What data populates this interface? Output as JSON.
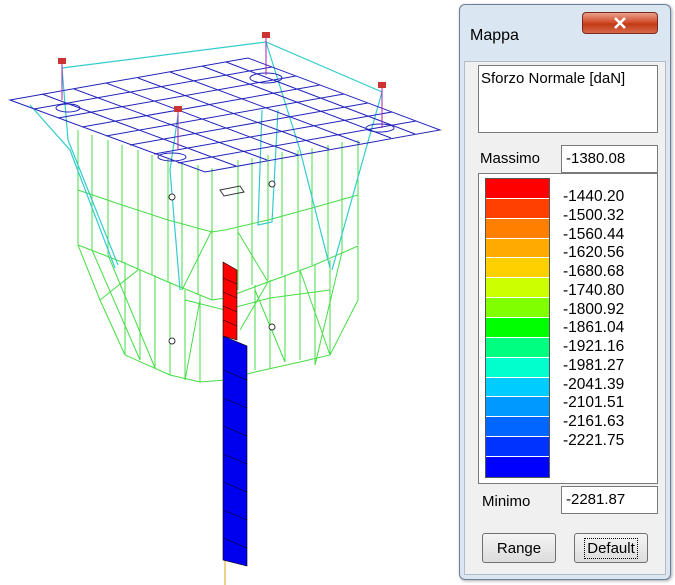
{
  "window": {
    "title": "Mappa",
    "close_icon": "close-x-icon",
    "quantity": "Sforzo Normale [daN]",
    "max_label": "Massimo",
    "max_value": "-1380.08",
    "min_label": "Minimo",
    "min_value": "-2281.87",
    "scale_values": [
      "-1440.20",
      "-1500.32",
      "-1560.44",
      "-1620.56",
      "-1680.68",
      "-1740.80",
      "-1800.92",
      "-1861.04",
      "-1921.16",
      "-1981.27",
      "-2041.39",
      "-2101.51",
      "-2161.63",
      "-2221.75"
    ],
    "scale_colors": [
      "#ff0000",
      "#ff4000",
      "#ff8000",
      "#ffaa00",
      "#ffd000",
      "#ccff00",
      "#80ff00",
      "#00ff00",
      "#00ff80",
      "#00ffcc",
      "#00ccff",
      "#0099ff",
      "#0066ff",
      "#0033ff",
      "#0000ff"
    ],
    "range_button": "Range",
    "default_button": "Default"
  },
  "viewport": {
    "plate_color": "#2222bb",
    "wall_color": "#44dd44",
    "brace_color": "#33cccc",
    "pile_high_color": "#ff0000",
    "pile_low_color": "#0000ff",
    "support_icon": "support-flag-icon"
  }
}
